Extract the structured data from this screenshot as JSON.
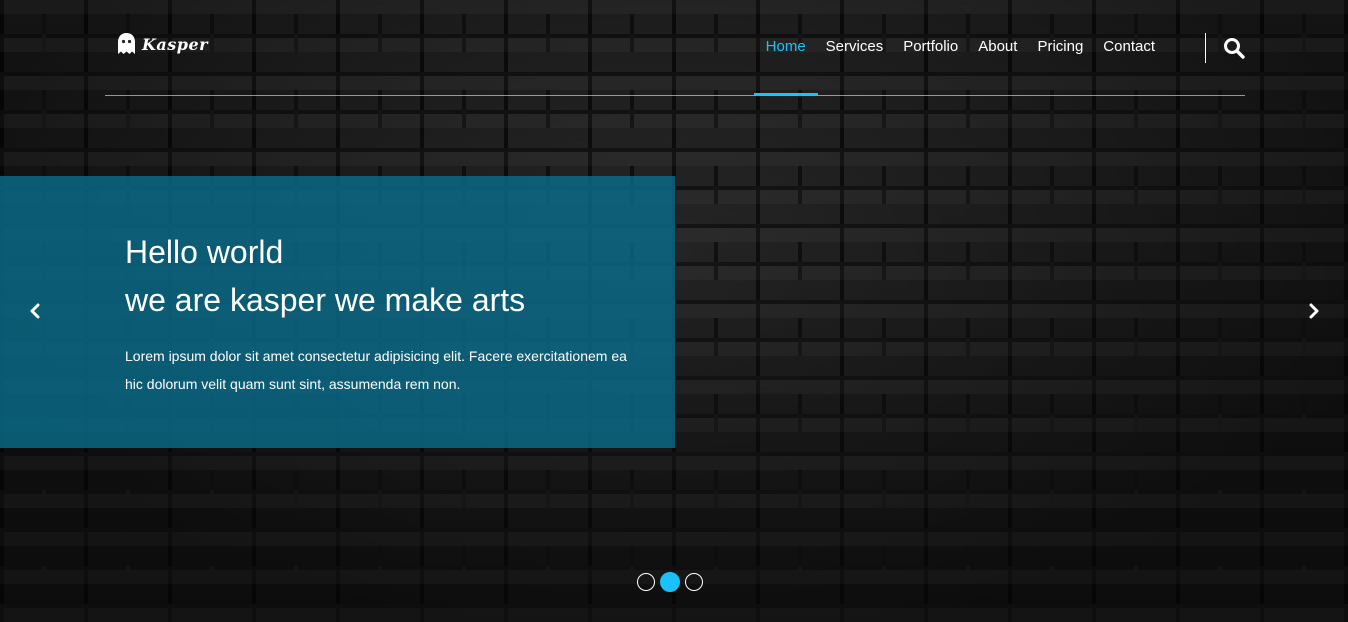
{
  "brand": {
    "name": "Kasper",
    "logo_icon": "ghost-icon"
  },
  "nav": {
    "items": [
      {
        "label": "Home",
        "active": true
      },
      {
        "label": "Services",
        "active": false
      },
      {
        "label": "Portfolio",
        "active": false
      },
      {
        "label": "About",
        "active": false
      },
      {
        "label": "Pricing",
        "active": false
      },
      {
        "label": "Contact",
        "active": false
      }
    ],
    "search_icon": "search-icon"
  },
  "slider": {
    "title_line1": "Hello world",
    "title_line2": "we are kasper we make arts",
    "text": "Lorem ipsum dolor sit amet consectetur adipisicing elit. Facere exercitationem ea hic dolorum velit quam sunt sint, assumenda rem non.",
    "prev_icon": "chevron-left-icon",
    "next_icon": "chevron-right-icon",
    "bullet_count": 3,
    "active_index": 1
  },
  "colors": {
    "accent": "#19c2fa",
    "panel": "#086b89"
  }
}
